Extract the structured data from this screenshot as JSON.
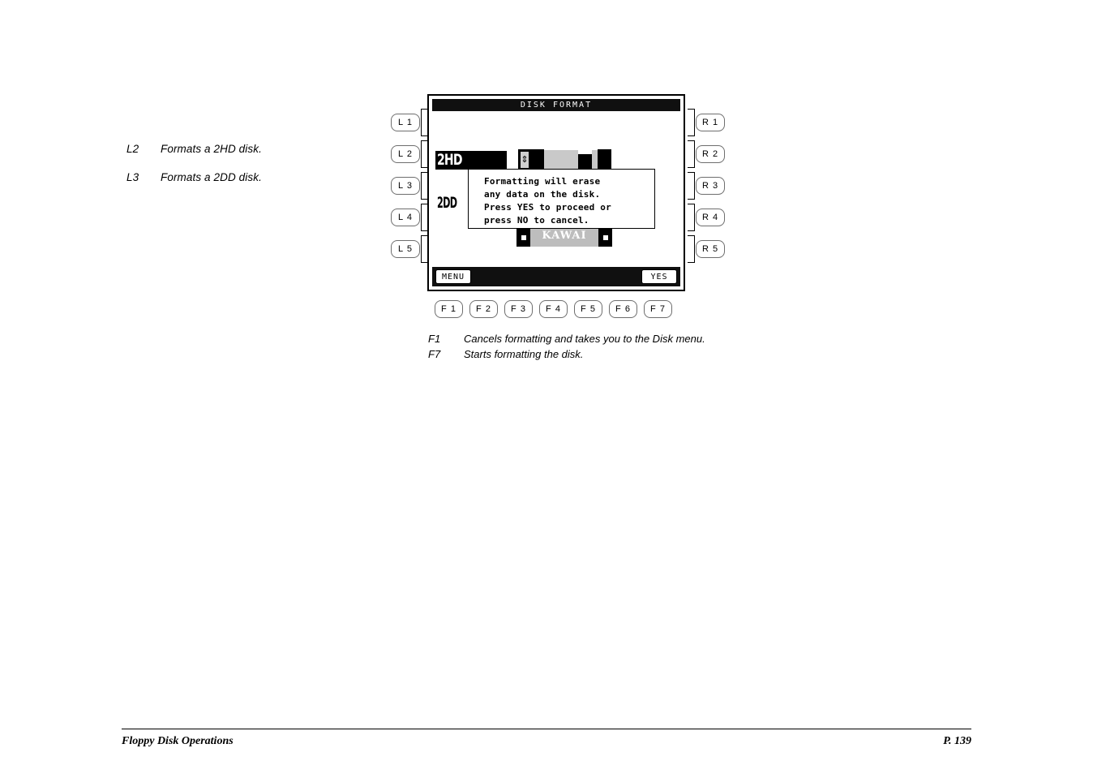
{
  "notes": {
    "items": [
      {
        "key": "L2",
        "desc": "Formats a 2HD disk."
      },
      {
        "key": "L3",
        "desc": "Formats a 2DD disk."
      }
    ]
  },
  "device": {
    "lcd": {
      "title": "DISK FORMAT",
      "options": [
        {
          "label": "2HD",
          "selected": true
        },
        {
          "label": "2DD",
          "selected": false
        }
      ],
      "disk_graphic": {
        "brand": "KAWAI",
        "arrow_glyph": "⇕"
      },
      "dialog": {
        "lines": [
          "Formatting will erase",
          "any data on the disk.",
          "Press YES to proceed or",
          "press NO to cancel."
        ]
      },
      "softkeys": {
        "left": "MENU",
        "right": "YES"
      }
    },
    "left_keys": [
      "L 1",
      "L 2",
      "L 3",
      "L 4",
      "L 5"
    ],
    "right_keys": [
      "R 1",
      "R 2",
      "R 3",
      "R 4",
      "R 5"
    ],
    "function_keys": [
      "F 1",
      "F 2",
      "F 3",
      "F 4",
      "F 5",
      "F 6",
      "F 7"
    ]
  },
  "caption": {
    "items": [
      {
        "key": "F1",
        "desc": "Cancels formatting and takes you to the Disk menu."
      },
      {
        "key": "F7",
        "desc": "Starts formatting the disk."
      }
    ]
  },
  "footer": {
    "section": "Floppy Disk Operations",
    "page": "P. 139"
  },
  "colors": {
    "ink": "#000000",
    "paper": "#ffffff",
    "lcd_bar": "#101010",
    "disk_body": "#c9c9c9",
    "key_outline": "#6e6e6e"
  }
}
